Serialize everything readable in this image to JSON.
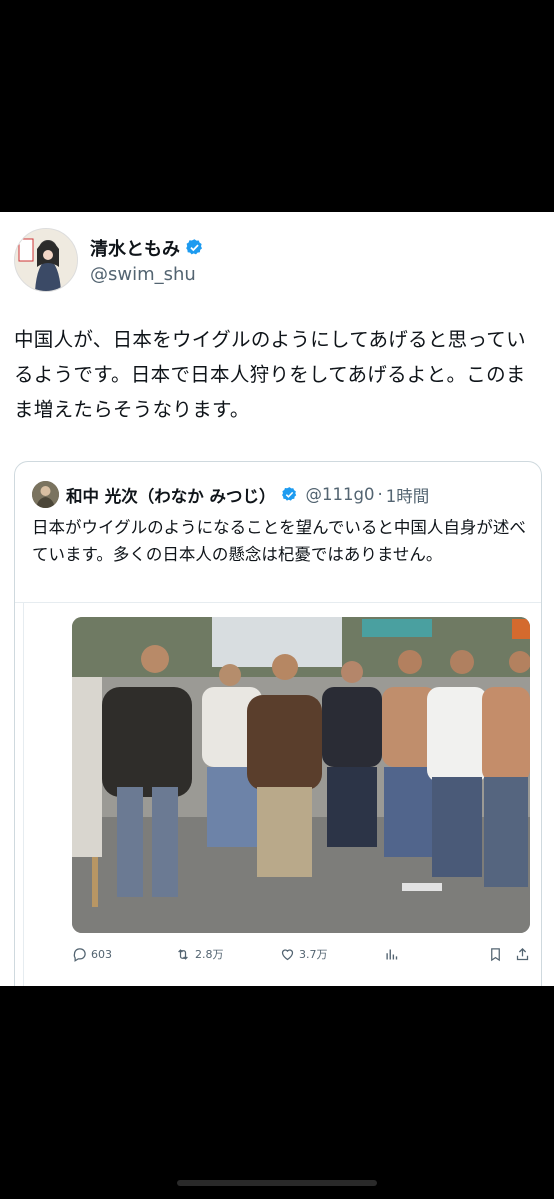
{
  "tweet": {
    "display_name": "清水ともみ",
    "handle": "@swim_shu",
    "text": "中国人が、日本をウイグルのようにしてあげると思っているようです。日本で日本人狩りをしてあげるよと。このまま増えたらそうなります。"
  },
  "quote": {
    "display_name": "和中 光次（わなか みつじ）",
    "handle": "@111g0",
    "time": "1時間",
    "text": "日本がウイグルのようになることを望んでいると中国人自身が述べています。多くの日本人の懸念は杞憂ではありません。",
    "image_alt_icon": "crowd-photo",
    "stats": {
      "replies": "603",
      "reposts": "2.8万",
      "likes": "3.7万"
    }
  },
  "colors": {
    "verified": "#1d9bf0",
    "muted": "#536471",
    "border": "#cfd9de"
  },
  "icons": [
    "verified-badge-icon",
    "reply-icon",
    "repost-icon",
    "like-icon",
    "views-icon",
    "bookmark-icon",
    "share-icon"
  ]
}
